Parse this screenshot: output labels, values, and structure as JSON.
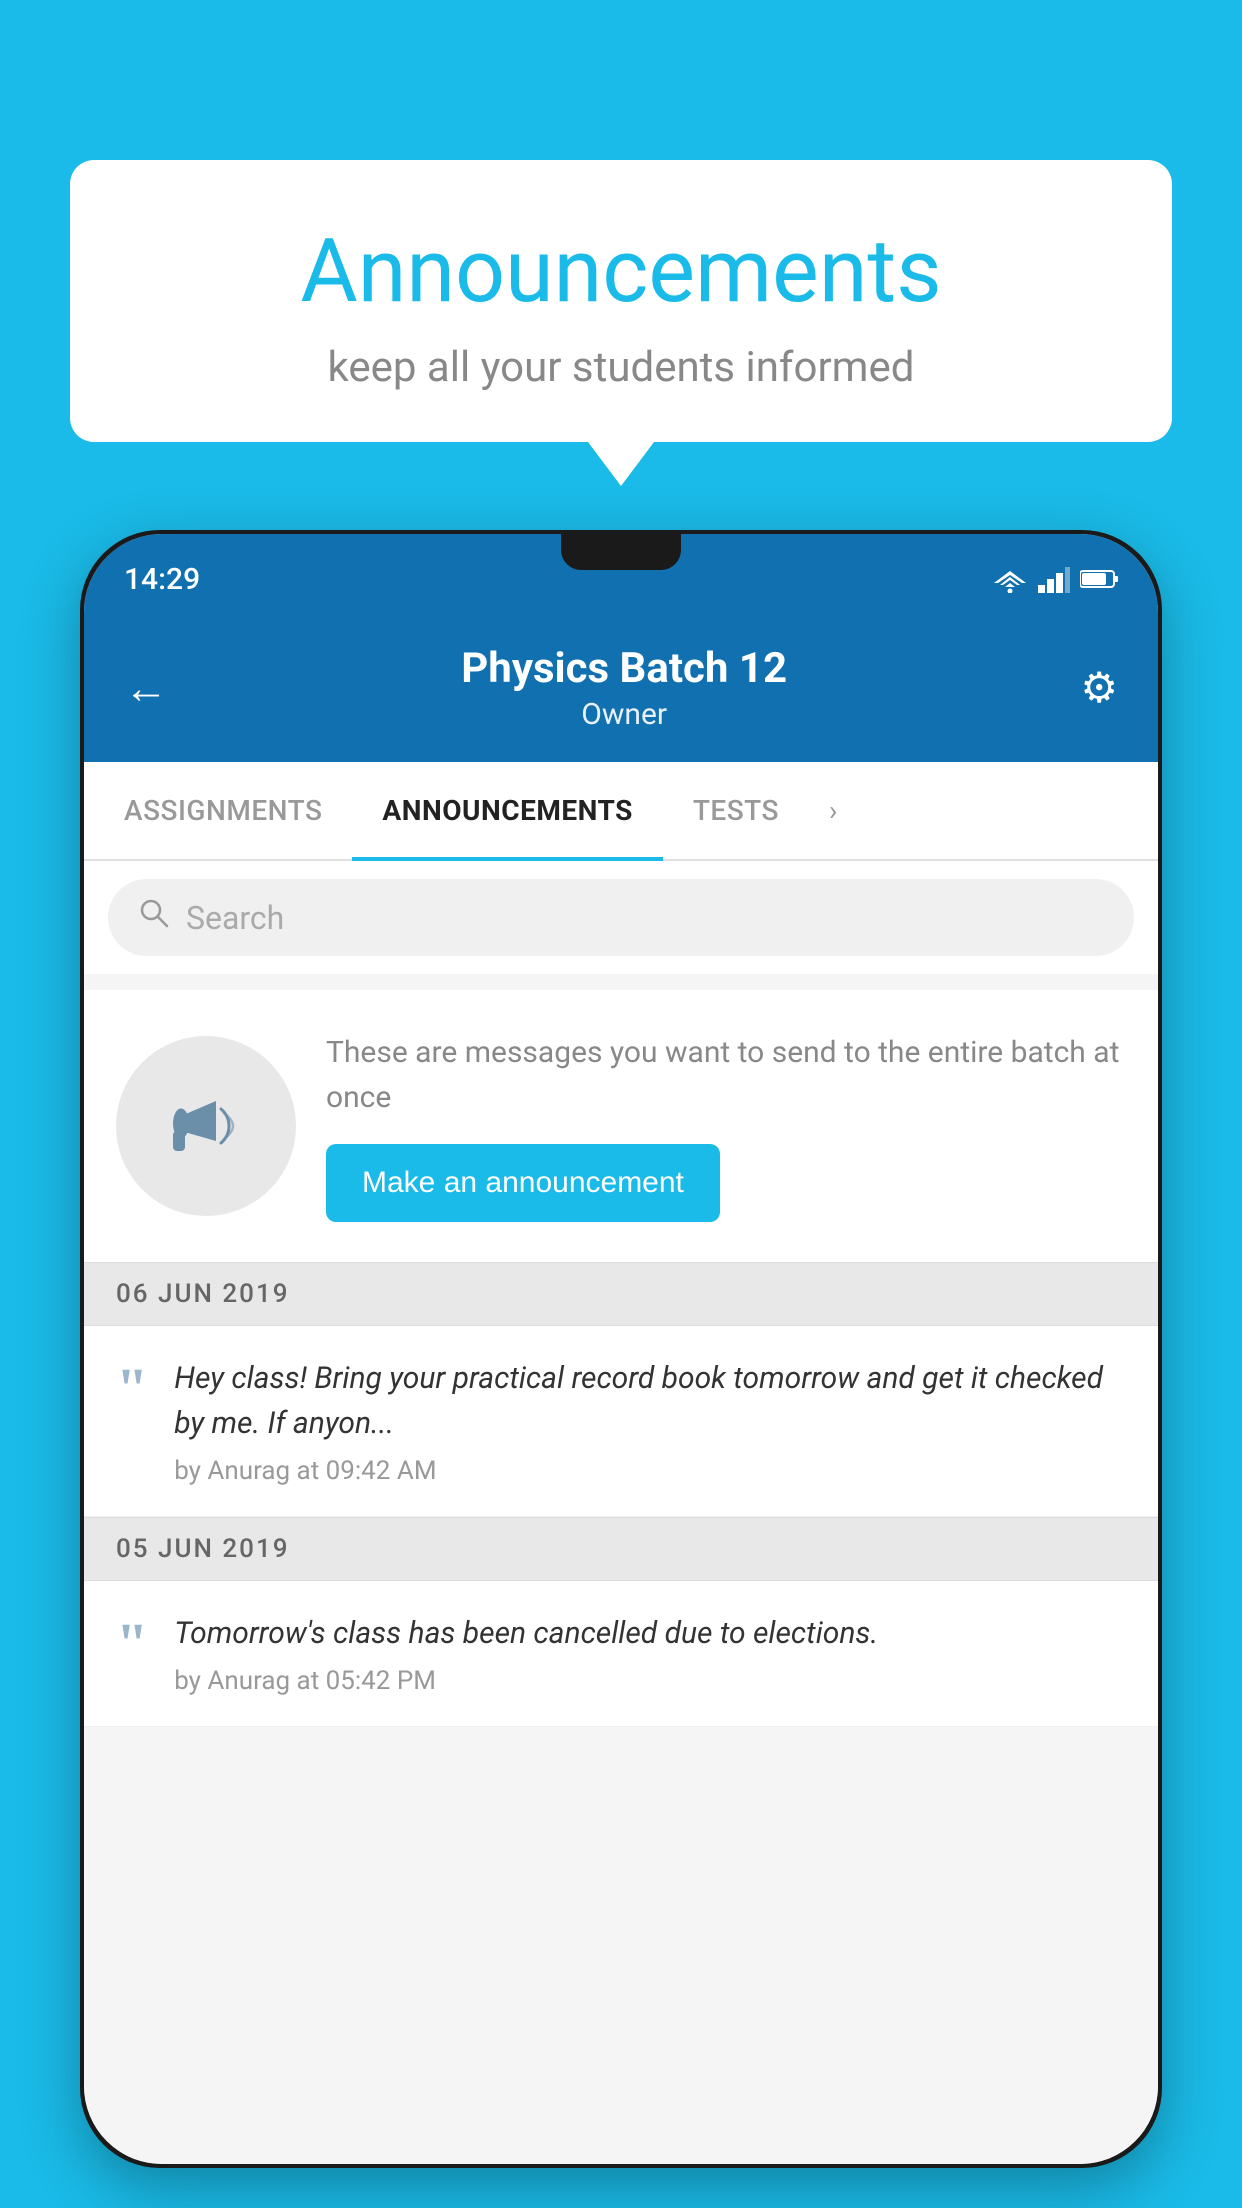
{
  "background": {
    "color": "#1ABBE8"
  },
  "speech_bubble": {
    "title": "Announcements",
    "subtitle": "keep all your students informed"
  },
  "phone": {
    "status_bar": {
      "time": "14:29"
    },
    "header": {
      "title": "Physics Batch 12",
      "subtitle": "Owner",
      "back_label": "←",
      "gear_label": "⚙"
    },
    "tabs": [
      {
        "label": "ASSIGNMENTS",
        "active": false
      },
      {
        "label": "ANNOUNCEMENTS",
        "active": true
      },
      {
        "label": "TESTS",
        "active": false
      }
    ],
    "search": {
      "placeholder": "Search"
    },
    "announcement_prompt": {
      "description": "These are messages you want to send to the entire batch at once",
      "button_label": "Make an announcement"
    },
    "date_groups": [
      {
        "date": "06  JUN  2019",
        "items": [
          {
            "message": "Hey class! Bring your practical record book tomorrow and get it checked by me. If anyon...",
            "meta": "by Anurag at 09:42 AM"
          }
        ]
      },
      {
        "date": "05  JUN  2019",
        "items": [
          {
            "message": "Tomorrow's class has been cancelled due to elections.",
            "meta": "by Anurag at 05:42 PM"
          }
        ]
      }
    ]
  }
}
